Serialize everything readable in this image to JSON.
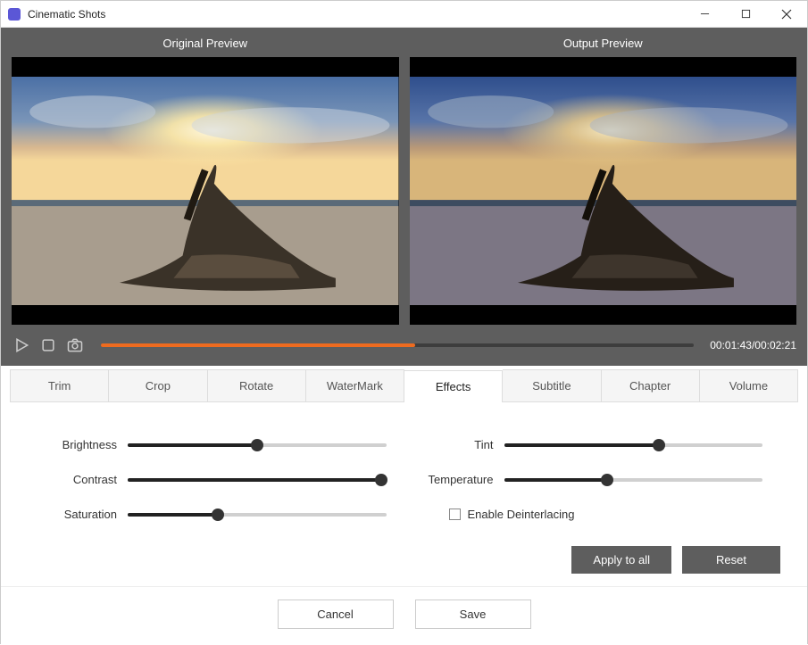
{
  "window": {
    "title": "Cinematic Shots"
  },
  "preview": {
    "original_label": "Original Preview",
    "output_label": "Output Preview"
  },
  "playback": {
    "current_time": "00:01:43",
    "total_time": "00:02:21",
    "time_display": "00:01:43/00:02:21",
    "progress_percent": 53
  },
  "tabs": [
    {
      "id": "trim",
      "label": "Trim",
      "active": false
    },
    {
      "id": "crop",
      "label": "Crop",
      "active": false
    },
    {
      "id": "rotate",
      "label": "Rotate",
      "active": false
    },
    {
      "id": "watermark",
      "label": "WaterMark",
      "active": false
    },
    {
      "id": "effects",
      "label": "Effects",
      "active": true
    },
    {
      "id": "subtitle",
      "label": "Subtitle",
      "active": false
    },
    {
      "id": "chapter",
      "label": "Chapter",
      "active": false
    },
    {
      "id": "volume",
      "label": "Volume",
      "active": false
    }
  ],
  "effects": {
    "brightness": {
      "label": "Brightness",
      "value": 50
    },
    "contrast": {
      "label": "Contrast",
      "value": 98
    },
    "saturation": {
      "label": "Saturation",
      "value": 35
    },
    "tint": {
      "label": "Tint",
      "value": 60
    },
    "temperature": {
      "label": "Temperature",
      "value": 40
    },
    "deinterlacing": {
      "label": "Enable Deinterlacing",
      "checked": false
    }
  },
  "actions": {
    "apply_all": "Apply to all",
    "reset": "Reset",
    "cancel": "Cancel",
    "save": "Save"
  },
  "colors": {
    "accent_orange": "#ee6b1f",
    "panel_gray": "#5e5e5e"
  }
}
